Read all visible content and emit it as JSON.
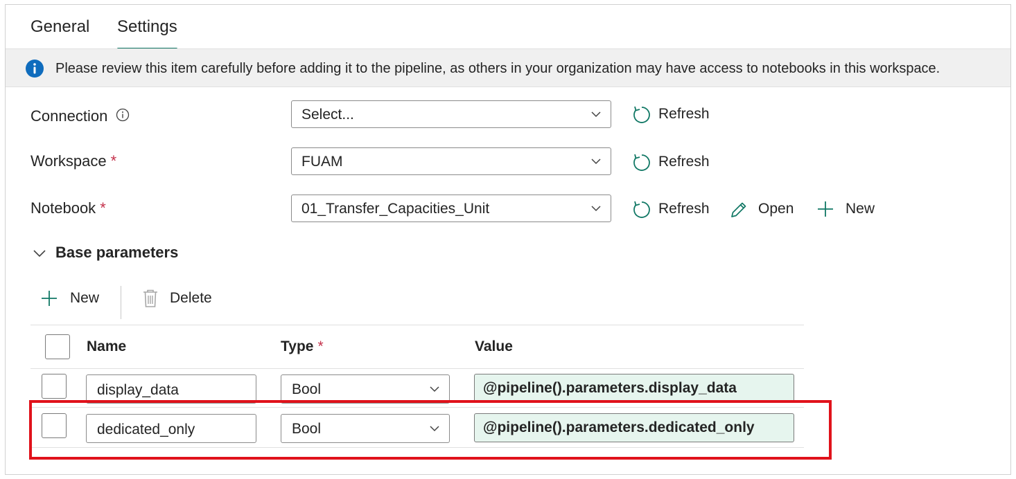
{
  "tabs": [
    {
      "label": "General",
      "active": false
    },
    {
      "label": "Settings",
      "active": true
    }
  ],
  "banner": {
    "icon": "info-icon",
    "message": "Please review this item carefully before adding it to the pipeline, as others in your organization may have access to notebooks in this workspace."
  },
  "form": {
    "connection": {
      "label": "Connection",
      "value": "Select...",
      "refresh": "Refresh"
    },
    "workspace": {
      "label": "Workspace",
      "required": "*",
      "value": "FUAM",
      "refresh": "Refresh"
    },
    "notebook": {
      "label": "Notebook",
      "required": "*",
      "value": "01_Transfer_Capacities_Unit",
      "refresh": "Refresh",
      "open": "Open",
      "new": "New"
    }
  },
  "base_parameters": {
    "title": "Base parameters",
    "toolbar": {
      "new": "New",
      "delete": "Delete"
    },
    "columns": {
      "name": "Name",
      "type": "Type",
      "type_required": "*",
      "value": "Value"
    },
    "rows": [
      {
        "name": "display_data",
        "type": "Bool",
        "value": "@pipeline().parameters.display_data"
      },
      {
        "name": "dedicated_only",
        "type": "Bool",
        "value": "@pipeline().parameters.dedicated_only"
      }
    ]
  },
  "colors": {
    "accent": "#117865",
    "required": "#c4314b",
    "info": "#0f6cbd",
    "highlight": "#e0121b",
    "expression_bg": "#e6f5ee"
  }
}
